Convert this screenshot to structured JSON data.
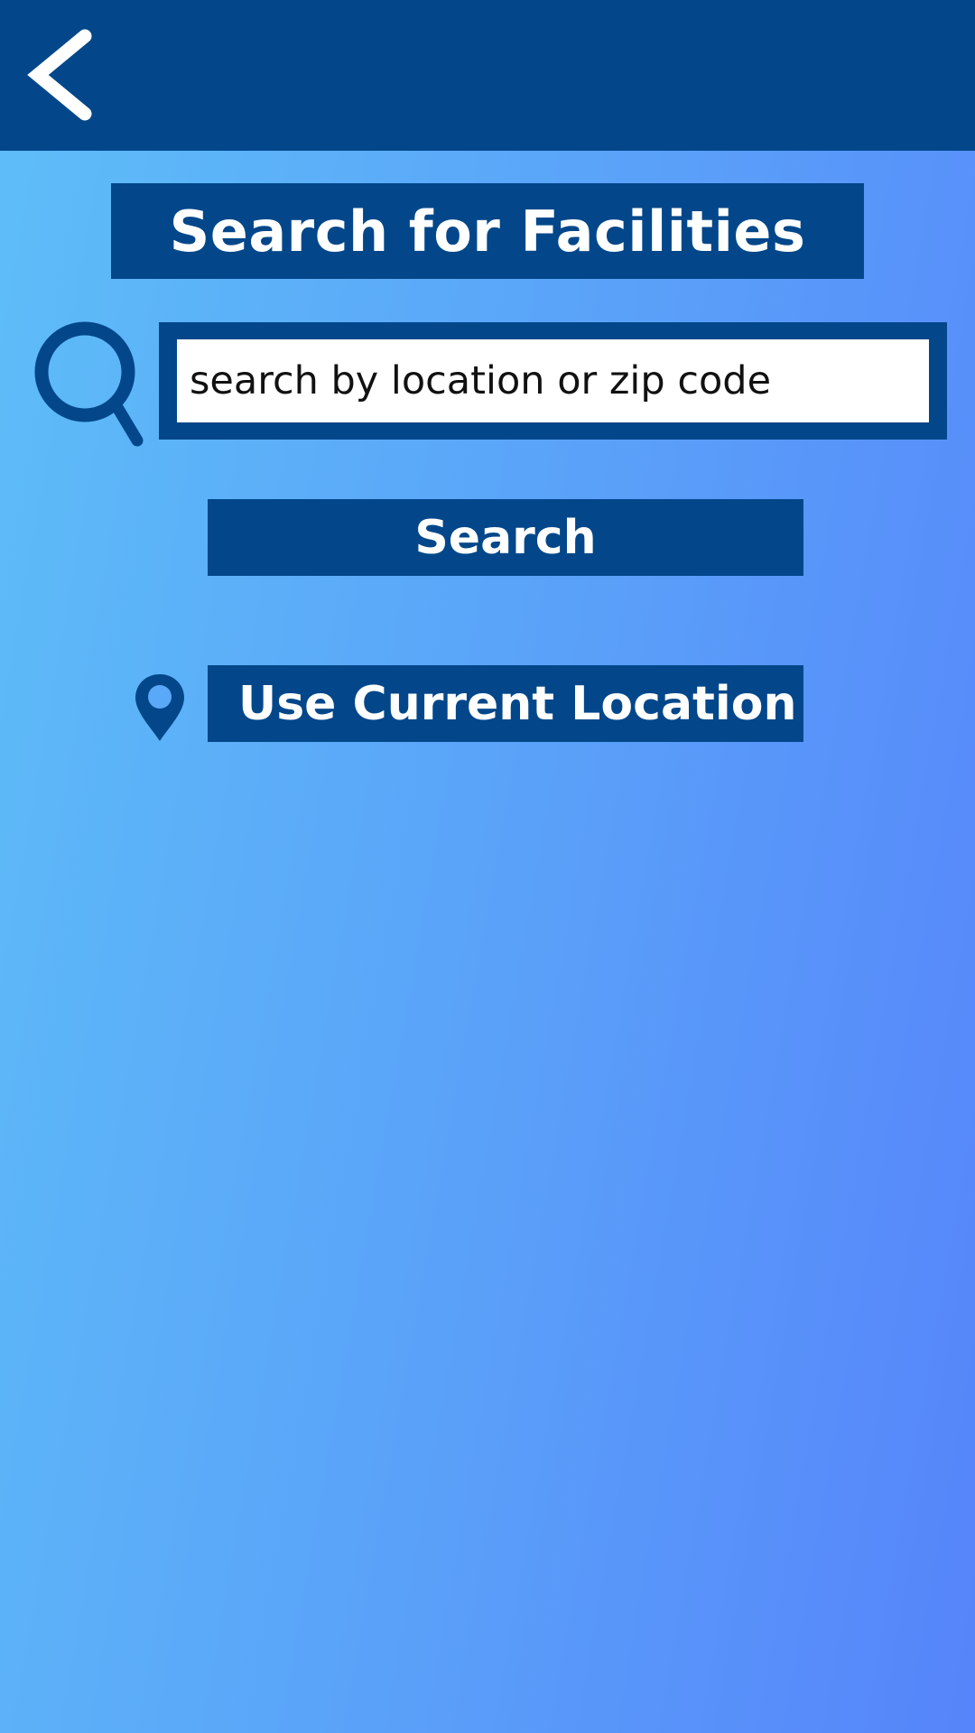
{
  "header": {
    "back_icon": "chevron-left-icon"
  },
  "page": {
    "title": "Search for Facilities"
  },
  "search": {
    "icon": "search-icon",
    "placeholder": "search by location or zip code",
    "value": "",
    "button_label": "Search"
  },
  "location": {
    "icon": "map-pin-icon",
    "button_label": "Use Current Location"
  },
  "colors": {
    "primary": "#03478a",
    "gradient_start": "#5ebef8",
    "gradient_end": "#5684fa",
    "input_background": "#ffffff"
  }
}
